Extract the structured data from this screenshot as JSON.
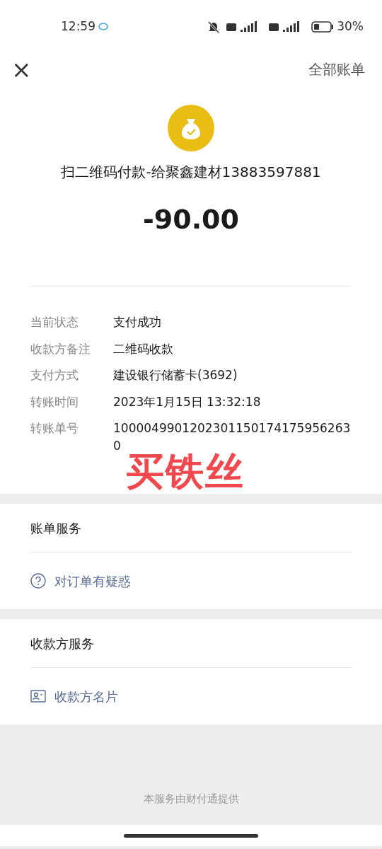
{
  "status_bar": {
    "time": "12:59",
    "battery": "30%"
  },
  "header": {
    "close": "×",
    "right_link": "全部账单"
  },
  "summary": {
    "title": "扫二维码付款-给聚鑫建材13883597881",
    "amount": "-90.00"
  },
  "details": [
    {
      "label": "当前状态",
      "value": "支付成功"
    },
    {
      "label": "收款方备注",
      "value": "二维码收款"
    },
    {
      "label": "支付方式",
      "value": "建设银行储蓄卡(3692)"
    },
    {
      "label": "转账时间",
      "value": "2023年1月15日 13:32:18"
    },
    {
      "label": "转账单号",
      "value": "10000499012023011501741759562630"
    }
  ],
  "annotation": "买铁丝",
  "sections": [
    {
      "title": "账单服务",
      "items": [
        {
          "kind": "question",
          "label": "对订单有疑惑"
        }
      ]
    },
    {
      "title": "收款方服务",
      "items": [
        {
          "kind": "card",
          "label": "收款方名片"
        }
      ]
    }
  ],
  "footer": "本服务由财付通提供"
}
